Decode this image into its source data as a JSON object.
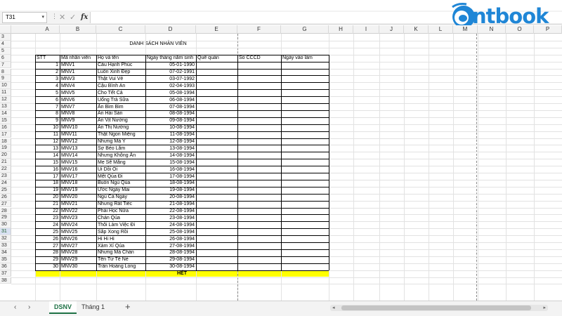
{
  "name_box": "T31",
  "formula": "",
  "logo": {
    "text": "ntbook",
    "color": "#1f86d6"
  },
  "columns": [
    "A",
    "B",
    "C",
    "D",
    "E",
    "F",
    "G",
    "H",
    "I",
    "J",
    "K",
    "L",
    "M",
    "N",
    "O",
    "P"
  ],
  "rows_visible": [
    3,
    4,
    5,
    6,
    7,
    8,
    9,
    10,
    11,
    12,
    13,
    14,
    15,
    16,
    17,
    18,
    19,
    20,
    21,
    22,
    23,
    24,
    25,
    26,
    27,
    28,
    29,
    30,
    31,
    32,
    33,
    34,
    35,
    36,
    37,
    38
  ],
  "active_row": "31",
  "sheet": {
    "title": "DANH SÁCH NHÂN VIÊN",
    "headers": [
      "STT",
      "Mã nhân viên",
      "Họ và tên",
      "Ngày tháng năm sinh",
      "Quê quán",
      "Số CCCD",
      "Ngày vào làm"
    ],
    "rows": [
      [
        "1",
        "MNV1",
        "Cầu Hạnh Phúc",
        "05-01-1990"
      ],
      [
        "2",
        "MNV1",
        "Luôn Xinh Đẹp",
        "07-02-1991"
      ],
      [
        "3",
        "MNV3",
        "Thật Vui Vẻ",
        "03-07-1992"
      ],
      [
        "4",
        "MNV4",
        "Cậu Bình An",
        "02-04-1993"
      ],
      [
        "5",
        "MNV5",
        "Cho Tết Cả",
        "05-08-1994"
      ],
      [
        "6",
        "MNV6",
        "Uống Trà Sữa",
        "06-08-1994"
      ],
      [
        "7",
        "MNV7",
        "Ăn Bim Bim",
        "07-08-1994"
      ],
      [
        "8",
        "MNV8",
        "Ăn Hải Sản",
        "08-08-1994"
      ],
      [
        "9",
        "MNV9",
        "Ăn Vịt Nướng",
        "09-08-1994"
      ],
      [
        "10",
        "MNV10",
        "Ăn Thị Nướng",
        "10-08-1994"
      ],
      [
        "11",
        "MNV11",
        "Thật Ngon Miệng",
        "11-08-1994"
      ],
      [
        "12",
        "MNV12",
        "Nhưng Mà Ý",
        "12-08-1994"
      ],
      [
        "13",
        "MNV13",
        "Sợ Béo Lắm",
        "13-08-1994"
      ],
      [
        "14",
        "MNV14",
        "Nhưng Không Ăn",
        "14-08-1994"
      ],
      [
        "15",
        "MNV15",
        "Mẹ Sẽ Mắng",
        "15-08-1994"
      ],
      [
        "16",
        "MNV16",
        "Ui Dồi Ôi",
        "16-08-1994"
      ],
      [
        "17",
        "MNV17",
        "Mệt Qúa Đi",
        "17-08-1994"
      ],
      [
        "18",
        "MNV18",
        "Buồn Ngủ Qúa",
        "18-08-1994"
      ],
      [
        "19",
        "MNV19",
        "Ước Ngày Mai",
        "19-08-1994"
      ],
      [
        "20",
        "MNV20",
        "Ngủ Cả Ngày",
        "20-08-1994"
      ],
      [
        "21",
        "MNV21",
        "Nhưng Rất Tiếc",
        "21-08-1994"
      ],
      [
        "22",
        "MNV22",
        "Phải Học Nữa",
        "22-08-1994"
      ],
      [
        "23",
        "MNV23",
        "Chán Qúa",
        "23-08-1994"
      ],
      [
        "24",
        "MNV24",
        "Thôi Làm Việc Đi",
        "24-08-1994"
      ],
      [
        "25",
        "MNV25",
        "Sắp Xong Rồi",
        "25-08-1994"
      ],
      [
        "26",
        "MNV26",
        "Hi Hi Hi",
        "26-08-1994"
      ],
      [
        "27",
        "MNV27",
        "Xàm Xí Qúa",
        "27-08-1994"
      ],
      [
        "28",
        "MNV28",
        "Nhưng Mà Chán",
        "28-08-1994"
      ],
      [
        "29",
        "MNV29",
        "Tên Từ Tế Nè",
        "29-08-1994"
      ],
      [
        "30",
        "MNV30",
        "Trần Hoàng Long",
        "30-08-1994"
      ]
    ],
    "footer": "HẾT",
    "footer_color": "#ffff00"
  },
  "tabs": {
    "active": "DSNV",
    "other": "Tháng 1",
    "add": "+"
  }
}
